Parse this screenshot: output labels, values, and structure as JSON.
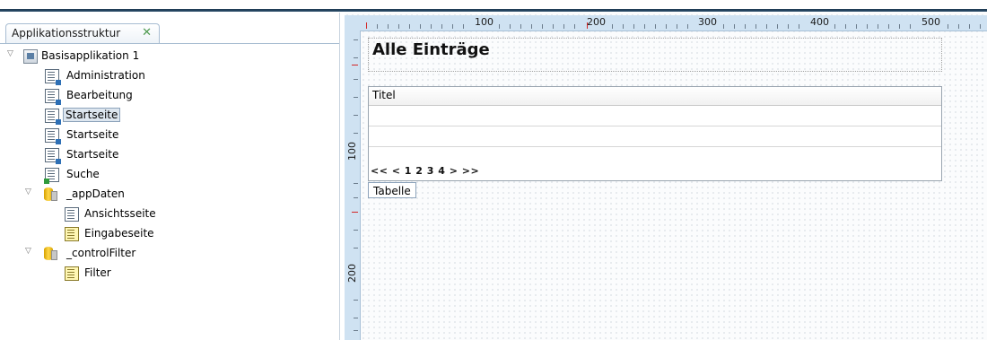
{
  "panel": {
    "tab_label": "Applikationsstruktur",
    "tab_close_icon": "close-icon"
  },
  "tree": {
    "root": "Basisapplikation 1",
    "pages": [
      "Administration",
      "Bearbeitung",
      "Startseite",
      "Startseite",
      "Startseite",
      "Suche"
    ],
    "selected_index": 2,
    "groups": [
      {
        "label": "_appDaten",
        "children": [
          "Ansichtsseite",
          "Eingabeseite"
        ]
      },
      {
        "label": "_controlFilter",
        "children": [
          "Filter"
        ]
      }
    ]
  },
  "ruler": {
    "h_labels": [
      "100",
      "200",
      "300",
      "400",
      "500"
    ],
    "v_labels": [
      "100",
      "200"
    ]
  },
  "canvas": {
    "heading": "Alle Einträge",
    "table_header": "Titel",
    "pager": "<< < 1 2 3 4 > >>",
    "table_label": "Tabelle"
  }
}
